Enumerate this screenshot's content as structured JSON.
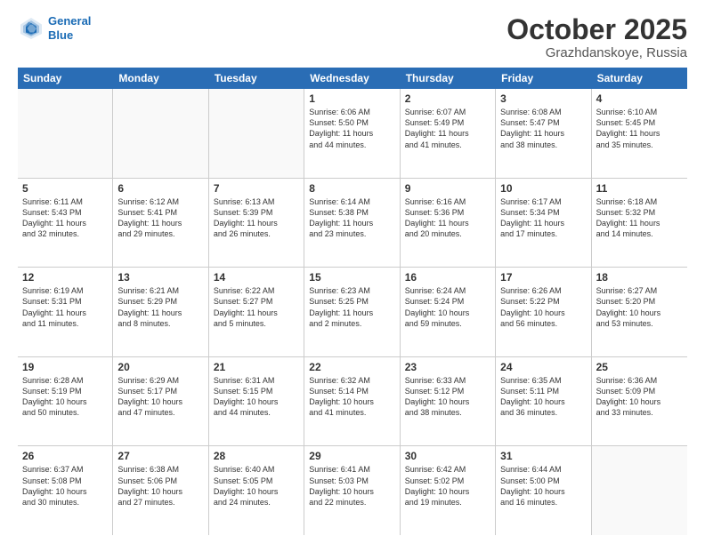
{
  "logo": {
    "line1": "General",
    "line2": "Blue"
  },
  "title": "October 2025",
  "location": "Grazhdanskoye, Russia",
  "days_of_week": [
    "Sunday",
    "Monday",
    "Tuesday",
    "Wednesday",
    "Thursday",
    "Friday",
    "Saturday"
  ],
  "rows": [
    [
      {
        "day": "",
        "text": ""
      },
      {
        "day": "",
        "text": ""
      },
      {
        "day": "",
        "text": ""
      },
      {
        "day": "1",
        "text": "Sunrise: 6:06 AM\nSunset: 5:50 PM\nDaylight: 11 hours\nand 44 minutes."
      },
      {
        "day": "2",
        "text": "Sunrise: 6:07 AM\nSunset: 5:49 PM\nDaylight: 11 hours\nand 41 minutes."
      },
      {
        "day": "3",
        "text": "Sunrise: 6:08 AM\nSunset: 5:47 PM\nDaylight: 11 hours\nand 38 minutes."
      },
      {
        "day": "4",
        "text": "Sunrise: 6:10 AM\nSunset: 5:45 PM\nDaylight: 11 hours\nand 35 minutes."
      }
    ],
    [
      {
        "day": "5",
        "text": "Sunrise: 6:11 AM\nSunset: 5:43 PM\nDaylight: 11 hours\nand 32 minutes."
      },
      {
        "day": "6",
        "text": "Sunrise: 6:12 AM\nSunset: 5:41 PM\nDaylight: 11 hours\nand 29 minutes."
      },
      {
        "day": "7",
        "text": "Sunrise: 6:13 AM\nSunset: 5:39 PM\nDaylight: 11 hours\nand 26 minutes."
      },
      {
        "day": "8",
        "text": "Sunrise: 6:14 AM\nSunset: 5:38 PM\nDaylight: 11 hours\nand 23 minutes."
      },
      {
        "day": "9",
        "text": "Sunrise: 6:16 AM\nSunset: 5:36 PM\nDaylight: 11 hours\nand 20 minutes."
      },
      {
        "day": "10",
        "text": "Sunrise: 6:17 AM\nSunset: 5:34 PM\nDaylight: 11 hours\nand 17 minutes."
      },
      {
        "day": "11",
        "text": "Sunrise: 6:18 AM\nSunset: 5:32 PM\nDaylight: 11 hours\nand 14 minutes."
      }
    ],
    [
      {
        "day": "12",
        "text": "Sunrise: 6:19 AM\nSunset: 5:31 PM\nDaylight: 11 hours\nand 11 minutes."
      },
      {
        "day": "13",
        "text": "Sunrise: 6:21 AM\nSunset: 5:29 PM\nDaylight: 11 hours\nand 8 minutes."
      },
      {
        "day": "14",
        "text": "Sunrise: 6:22 AM\nSunset: 5:27 PM\nDaylight: 11 hours\nand 5 minutes."
      },
      {
        "day": "15",
        "text": "Sunrise: 6:23 AM\nSunset: 5:25 PM\nDaylight: 11 hours\nand 2 minutes."
      },
      {
        "day": "16",
        "text": "Sunrise: 6:24 AM\nSunset: 5:24 PM\nDaylight: 10 hours\nand 59 minutes."
      },
      {
        "day": "17",
        "text": "Sunrise: 6:26 AM\nSunset: 5:22 PM\nDaylight: 10 hours\nand 56 minutes."
      },
      {
        "day": "18",
        "text": "Sunrise: 6:27 AM\nSunset: 5:20 PM\nDaylight: 10 hours\nand 53 minutes."
      }
    ],
    [
      {
        "day": "19",
        "text": "Sunrise: 6:28 AM\nSunset: 5:19 PM\nDaylight: 10 hours\nand 50 minutes."
      },
      {
        "day": "20",
        "text": "Sunrise: 6:29 AM\nSunset: 5:17 PM\nDaylight: 10 hours\nand 47 minutes."
      },
      {
        "day": "21",
        "text": "Sunrise: 6:31 AM\nSunset: 5:15 PM\nDaylight: 10 hours\nand 44 minutes."
      },
      {
        "day": "22",
        "text": "Sunrise: 6:32 AM\nSunset: 5:14 PM\nDaylight: 10 hours\nand 41 minutes."
      },
      {
        "day": "23",
        "text": "Sunrise: 6:33 AM\nSunset: 5:12 PM\nDaylight: 10 hours\nand 38 minutes."
      },
      {
        "day": "24",
        "text": "Sunrise: 6:35 AM\nSunset: 5:11 PM\nDaylight: 10 hours\nand 36 minutes."
      },
      {
        "day": "25",
        "text": "Sunrise: 6:36 AM\nSunset: 5:09 PM\nDaylight: 10 hours\nand 33 minutes."
      }
    ],
    [
      {
        "day": "26",
        "text": "Sunrise: 6:37 AM\nSunset: 5:08 PM\nDaylight: 10 hours\nand 30 minutes."
      },
      {
        "day": "27",
        "text": "Sunrise: 6:38 AM\nSunset: 5:06 PM\nDaylight: 10 hours\nand 27 minutes."
      },
      {
        "day": "28",
        "text": "Sunrise: 6:40 AM\nSunset: 5:05 PM\nDaylight: 10 hours\nand 24 minutes."
      },
      {
        "day": "29",
        "text": "Sunrise: 6:41 AM\nSunset: 5:03 PM\nDaylight: 10 hours\nand 22 minutes."
      },
      {
        "day": "30",
        "text": "Sunrise: 6:42 AM\nSunset: 5:02 PM\nDaylight: 10 hours\nand 19 minutes."
      },
      {
        "day": "31",
        "text": "Sunrise: 6:44 AM\nSunset: 5:00 PM\nDaylight: 10 hours\nand 16 minutes."
      },
      {
        "day": "",
        "text": ""
      }
    ]
  ]
}
